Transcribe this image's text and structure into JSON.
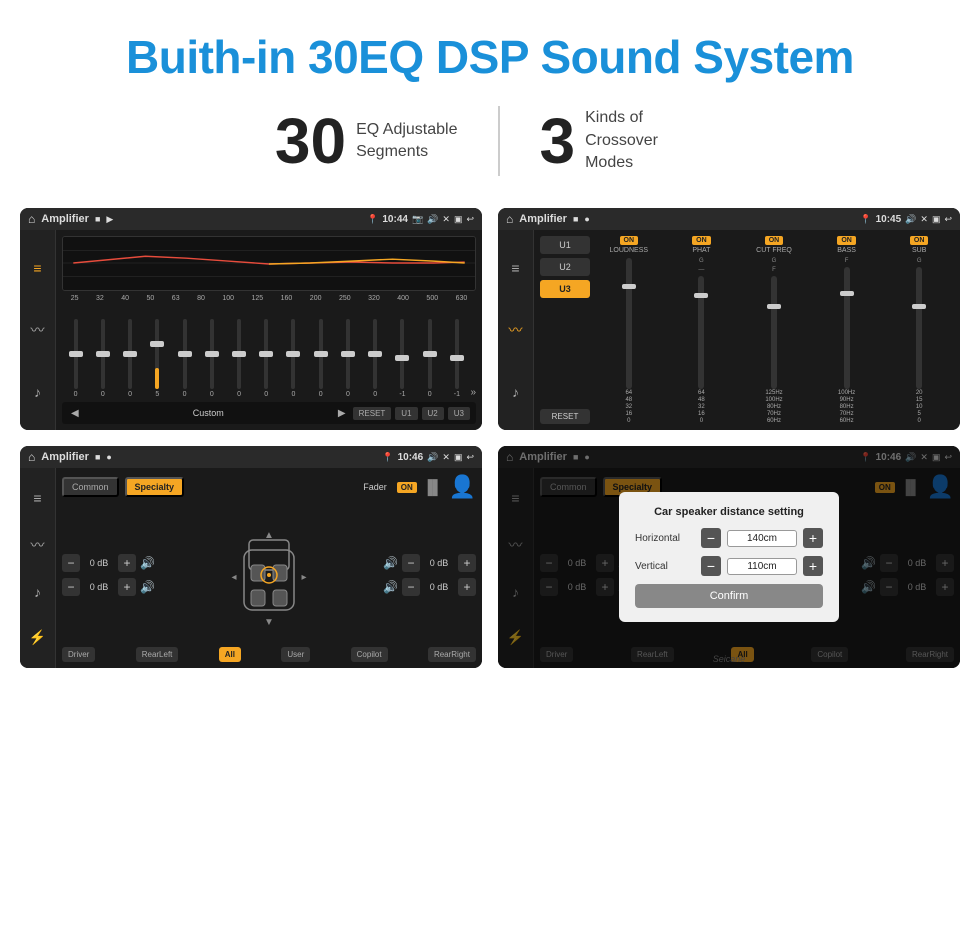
{
  "page": {
    "title": "Buith-in 30EQ DSP Sound System",
    "stat1_number": "30",
    "stat1_desc_line1": "EQ Adjustable",
    "stat1_desc_line2": "Segments",
    "stat2_number": "3",
    "stat2_desc_line1": "Kinds of",
    "stat2_desc_line2": "Crossover Modes"
  },
  "screens": {
    "screen1": {
      "title": "Amplifier",
      "time": "10:44",
      "eq_labels": [
        "25",
        "32",
        "40",
        "50",
        "63",
        "80",
        "100",
        "125",
        "160",
        "200",
        "250",
        "320",
        "400",
        "500",
        "630"
      ],
      "eq_values": [
        "0",
        "0",
        "0",
        "5",
        "0",
        "0",
        "0",
        "0",
        "0",
        "0",
        "0",
        "0",
        "-1",
        "0",
        "-1"
      ],
      "preset_label": "Custom",
      "buttons": [
        "RESET",
        "U1",
        "U2",
        "U3"
      ]
    },
    "screen2": {
      "title": "Amplifier",
      "time": "10:45",
      "presets": [
        "U1",
        "U2",
        "U3"
      ],
      "active_preset": "U3",
      "channels": [
        "LOUDNESS",
        "PHAT",
        "CUT FREQ",
        "BASS",
        "SUB"
      ],
      "channel_states": [
        "ON",
        "ON",
        "ON",
        "ON",
        "ON"
      ],
      "reset_label": "RESET"
    },
    "screen3": {
      "title": "Amplifier",
      "time": "10:46",
      "tabs": [
        "Common",
        "Specialty"
      ],
      "active_tab": "Specialty",
      "fader_label": "Fader",
      "fader_state": "ON",
      "db_values": [
        "0 dB",
        "0 dB",
        "0 dB",
        "0 dB"
      ],
      "seat_buttons": [
        "Driver",
        "RearLeft",
        "All",
        "User",
        "Copilot",
        "RearRight"
      ],
      "active_seat": "All"
    },
    "screen4": {
      "title": "Amplifier",
      "time": "10:46",
      "tabs": [
        "Common",
        "Specialty"
      ],
      "active_tab": "Specialty",
      "dialog": {
        "title": "Car speaker distance setting",
        "horizontal_label": "Horizontal",
        "horizontal_value": "140cm",
        "vertical_label": "Vertical",
        "vertical_value": "110cm",
        "confirm_label": "Confirm"
      },
      "db_values": [
        "0 dB",
        "0 dB"
      ],
      "seat_buttons": [
        "Driver",
        "RearLeft",
        "All",
        "User",
        "Copilot",
        "RearRight"
      ]
    }
  },
  "icons": {
    "home": "⌂",
    "record": "●",
    "pin": "📍",
    "camera": "📷",
    "speaker": "🔊",
    "close": "✕",
    "return": "↩",
    "eq": "≡",
    "wave": "〰",
    "volume": "♪",
    "settings": "⚙",
    "person": "👤",
    "arrow_up": "▲",
    "arrow_down": "▼",
    "arrow_left": "◀",
    "arrow_right": "▶",
    "arrow_left_nav": "◂",
    "arrow_right_nav": "▸",
    "chevrons": "»"
  },
  "watermark": "Seicane"
}
